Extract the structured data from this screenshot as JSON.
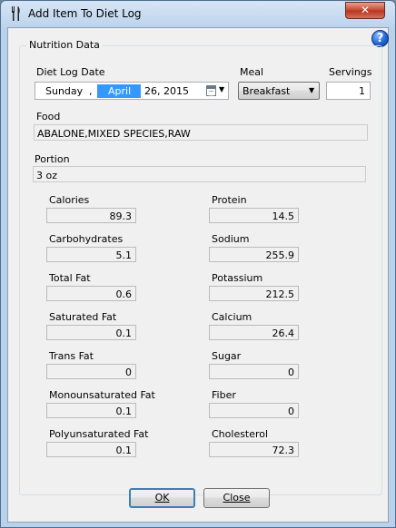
{
  "window": {
    "title": "Add Item To Diet Log",
    "close_label": "✕"
  },
  "help": {
    "symbol": "?"
  },
  "group": {
    "legend": "Nutrition Data"
  },
  "date": {
    "label": "Diet Log Date",
    "day": "Sunday",
    "comma": ",",
    "month": "April",
    "rest": "26, 2015"
  },
  "meal": {
    "label": "Meal",
    "value": "Breakfast"
  },
  "servings": {
    "label": "Servings",
    "value": "1"
  },
  "food": {
    "label": "Food",
    "value": "ABALONE,MIXED SPECIES,RAW"
  },
  "portion": {
    "label": "Portion",
    "value": "3 oz"
  },
  "nutrients_left": [
    {
      "label": "Calories",
      "value": "89.3"
    },
    {
      "label": "Carbohydrates",
      "value": "5.1"
    },
    {
      "label": "Total Fat",
      "value": "0.6"
    },
    {
      "label": "Saturated Fat",
      "value": "0.1"
    },
    {
      "label": "Trans Fat",
      "value": "0"
    },
    {
      "label": "Monounsaturated Fat",
      "value": "0.1"
    },
    {
      "label": "Polyunsaturated Fat",
      "value": "0.1"
    }
  ],
  "nutrients_right": [
    {
      "label": "Protein",
      "value": "14.5"
    },
    {
      "label": "Sodium",
      "value": "255.9"
    },
    {
      "label": "Potassium",
      "value": "212.5"
    },
    {
      "label": "Calcium",
      "value": "26.4"
    },
    {
      "label": "Sugar",
      "value": "0"
    },
    {
      "label": "Fiber",
      "value": "0"
    },
    {
      "label": "Cholesterol",
      "value": "72.3"
    }
  ],
  "buttons": {
    "ok": "OK",
    "close": "Close"
  },
  "colors": {
    "selection": "#3399ff",
    "window_frame": "#b9d1ea",
    "client": "#f0f0f0"
  },
  "icons": {
    "app": "fork-knife-icon",
    "help": "help-icon",
    "calendar": "calendar-icon",
    "dropdown": "chevron-down-icon"
  }
}
